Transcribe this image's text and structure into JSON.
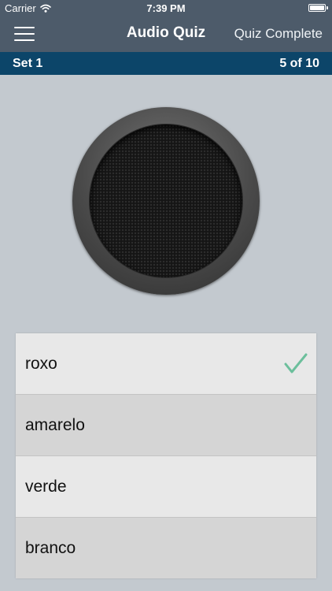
{
  "status_bar": {
    "carrier": "Carrier",
    "time": "7:39 PM",
    "wifi_icon": "wifi-icon",
    "battery_icon": "battery-icon"
  },
  "nav": {
    "menu_icon": "hamburger-menu-icon",
    "title": "Audio Quiz",
    "action_label": "Quiz Complete"
  },
  "set_bar": {
    "set_label": "Set 1",
    "progress": "5 of 10"
  },
  "speaker": {
    "icon": "speaker-icon"
  },
  "answers": [
    {
      "label": "roxo",
      "selected": true
    },
    {
      "label": "amarelo",
      "selected": false
    },
    {
      "label": "verde",
      "selected": false
    },
    {
      "label": "branco",
      "selected": false
    }
  ],
  "colors": {
    "nav_bg": "#4d5b6a",
    "set_bar_bg": "#0c4569",
    "page_bg": "#c3c9cf",
    "check": "#6cbf9c"
  }
}
